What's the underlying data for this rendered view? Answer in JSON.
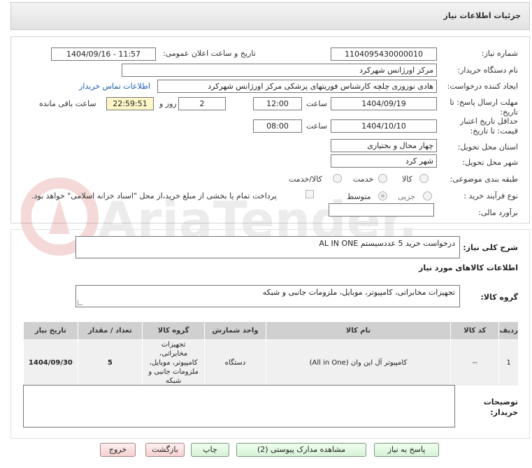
{
  "header": {
    "title": "جزئیات اطلاعات نیاز"
  },
  "form": {
    "need_number": {
      "label": "شماره نیاز:",
      "value": "1104095430000010"
    },
    "announce_datetime": {
      "label": "تاریخ و ساعت اعلان عمومی:",
      "value": "1404/09/16 - 11:57"
    },
    "buyer_org": {
      "label": "نام دستگاه خریدار:",
      "value": "مرکز اورژانس شهرکرد"
    },
    "requester": {
      "label": "ایجاد کننده درخواست:",
      "value": "هادی نوروزی چلچه کارشناس فوریتهای پزشکی مرکز اورژانس شهرکرد",
      "contact_link": "اطلاعات تماس خریدار"
    },
    "reply_deadline": {
      "label": "مهلت ارسال پاسخ: تا تاریخ:",
      "date": "1404/09/19",
      "time_label": "ساعت",
      "time": "12:00",
      "days": "2",
      "days_label": "روز و",
      "remaining": "22:59:51",
      "remaining_label": "ساعت باقی مانده"
    },
    "validity": {
      "label": "حداقل تاریخ اعتبار قیمت: تا تاریخ:",
      "date": "1404/10/10",
      "time_label": "ساعت",
      "time": "08:00"
    },
    "province": {
      "label": "استان محل تحویل:",
      "value": "چهار محال و بختیاری"
    },
    "city": {
      "label": "شهر محل تحویل:",
      "value": "شهر کرد"
    },
    "category": {
      "label": "طبقه بندی موضوعی:",
      "options": [
        "کالا",
        "خدمت",
        "کالا/خدمت"
      ]
    },
    "process": {
      "label": "نوع فرآیند خرید :",
      "options": [
        "جزیی",
        "متوسط"
      ],
      "payment_note": "پرداخت تمام یا بخشی از مبلغ خرید،از محل \"اسناد خزانه اسلامی\" خواهد بود."
    },
    "estimate": {
      "label": "برآورد مالی:",
      "value": ""
    }
  },
  "summary": {
    "label": "شرح کلی نیاز:",
    "value": "درخواست خرید 5 عددسیستم AL IN ONE"
  },
  "goods_info_title": "اطلاعات کالاهای مورد نیاز",
  "goods_group": {
    "label": "گروه کالا:",
    "value": "تجهیزات مخابراتی، کامپیوتر، موبایل، ملزومات جانبی و شبکه"
  },
  "table": {
    "headers": [
      "ردیف",
      "کد کالا",
      "نام کالا",
      "واحد شمارش",
      "گروه کالا",
      "تعداد / مقدار",
      "تاریخ نیاز"
    ],
    "rows": [
      [
        "1",
        "--",
        "کامپیوتر آل این وان (All in One)",
        "دستگاه",
        "تجهیزات مخابراتی، کامپیوتر، موبایل، ملزومات جانبی و شبکه",
        "5",
        "1404/09/30"
      ]
    ]
  },
  "buyer_notes": {
    "label": "توضیحات خریدار:",
    "value": ""
  },
  "buttons": {
    "reply": "پاسخ به نیاز",
    "attachments": "مشاهده مدارک پیوستی (2)",
    "print": "چاپ",
    "back": "بازگشت",
    "exit": "خروج"
  },
  "watermark": "AriaTender.neT"
}
